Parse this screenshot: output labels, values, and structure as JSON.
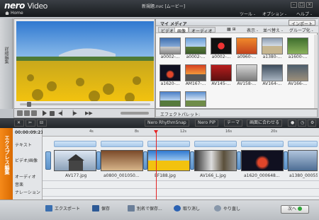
{
  "app": {
    "logo": "nero",
    "logo_suffix": "Video",
    "home": "Home",
    "window_title": "新規題.nvc [ムービー]"
  },
  "menu": {
    "tools": "ツール ‐",
    "options": "オプション ‐",
    "help": "ヘルプ ‐"
  },
  "left_tab": {
    "label": "詳細編集"
  },
  "media": {
    "title": "マイ メディア",
    "import": "インポート",
    "tabs": [
      "ビデオ",
      "画像",
      "オーディオ"
    ],
    "tools": {
      "display": "表示 ‐",
      "sort": "並べ替え ‐",
      "group": "グループ化 ‐"
    },
    "thumbs": [
      {
        "label": "a0002-..."
      },
      {
        "label": "a0002-..."
      },
      {
        "label": "a0002-..."
      },
      {
        "label": "a0960-..."
      },
      {
        "label": "a1380-..."
      },
      {
        "label": "a1600-..."
      },
      {
        "label": "a1620-..."
      },
      {
        "label": "AM167-..."
      },
      {
        "label": "AV145-..."
      },
      {
        "label": "AV158-..."
      },
      {
        "label": "AV164-..."
      },
      {
        "label": "AV166-..."
      }
    ]
  },
  "effect_palette": {
    "label": "エフェクトパレット:"
  },
  "toolbar": {
    "rhythm": "Nero RhythmSnap",
    "pip": "Nero PiP",
    "theme": "テーマ",
    "fit": "画面に合わせる"
  },
  "timeline": {
    "side_label": "エクスプレス編集",
    "timecode": "00:00:09:21",
    "tracks": [
      "テキスト",
      "ビデオ/画像",
      "オーディオ",
      "音楽",
      "ナレーション"
    ],
    "ticks": [
      "4s",
      "8s",
      "12s",
      "16s",
      "20s"
    ],
    "clips": [
      "AV177.jpg",
      "a0800_001050...",
      "EF188.jpg",
      "AV166_L.jpg",
      "a1620_000648...",
      "a1380_00055..."
    ]
  },
  "bottom": {
    "export": "エクスポート",
    "save": "保存",
    "save_as": "別名で保存...",
    "undo": "取り消し",
    "redo": "やり直し",
    "next": "次へ"
  }
}
